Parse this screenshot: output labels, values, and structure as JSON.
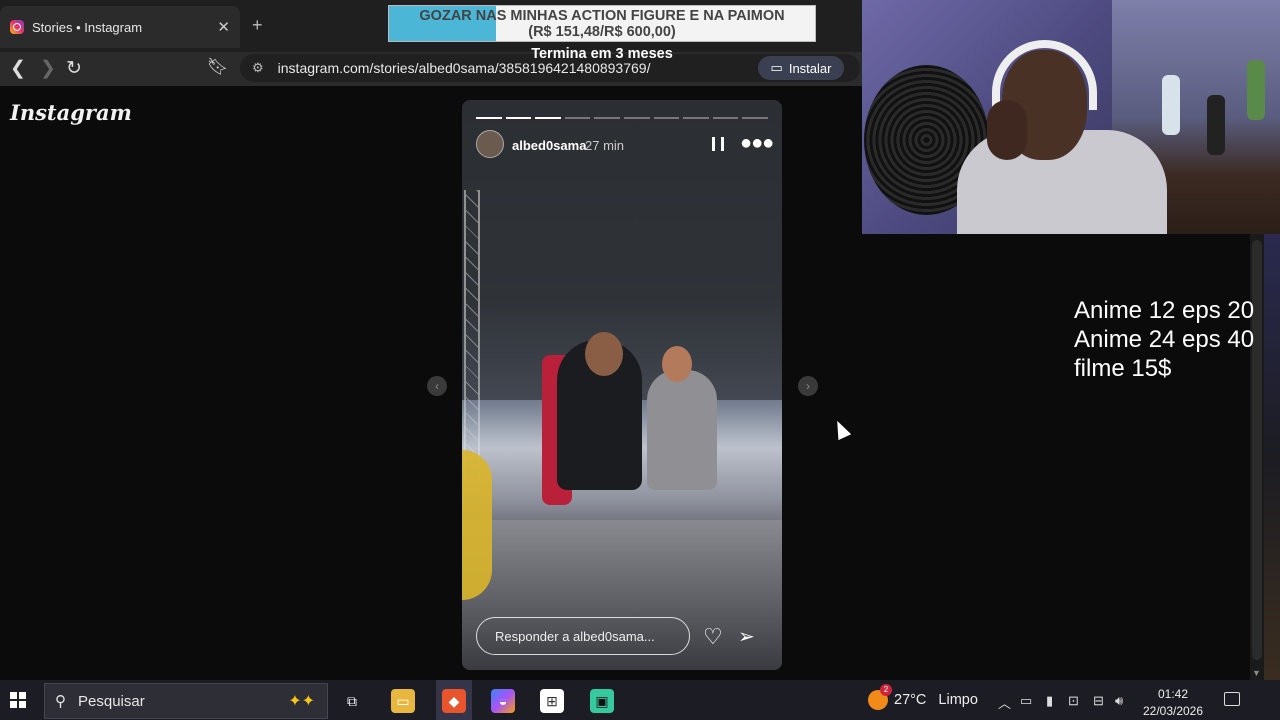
{
  "browser": {
    "tab_title": "Stories • Instagram",
    "tab_close": "✕",
    "new_tab": "+",
    "url": "instagram.com/stories/albed0sama/3858196421480893769/",
    "install_label": "Instalar"
  },
  "goal": {
    "text_line1": "GOZAR NAS MINHAS ACTION FIGURE E NA PAIMON",
    "text_line2": "(R$ 151,48/R$ 600,00)",
    "subtitle": "Termina em 3 meses",
    "progress": 0.25
  },
  "instagram": {
    "logo": "Instagram"
  },
  "story": {
    "username": "albed0sama",
    "time": "27 min",
    "reply_placeholder": "Responder a albed0sama...",
    "segments_total": 10,
    "segments_done": 3
  },
  "overlay": {
    "line1": "Anime 12 eps 20",
    "line2": "Anime 24 eps 40",
    "line3": "filme 15$"
  },
  "taskbar": {
    "search_placeholder": "Pesquisar",
    "weather_temp": "27°C",
    "weather_desc": "Limpo",
    "weather_badge": "2",
    "time": "01:42",
    "date": "22/03/2026"
  },
  "colors": {
    "goal_fill": "#4bb6d6",
    "accent_install": "#3a3f52"
  }
}
